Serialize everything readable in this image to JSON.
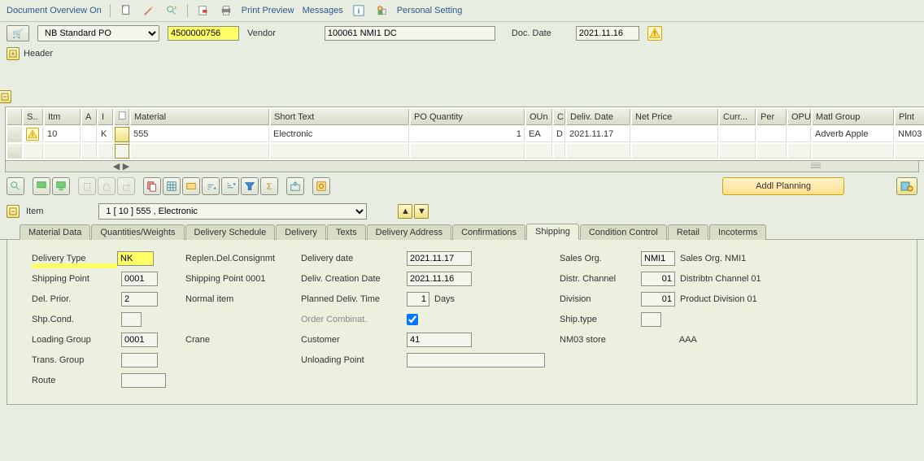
{
  "toolbar": {
    "doc_overview": "Document Overview On",
    "print_preview": "Print Preview",
    "messages": "Messages",
    "personal": "Personal Setting"
  },
  "header": {
    "doc_type_icon": "🛒",
    "doc_type": "NB Standard PO",
    "po_number": "4500000756",
    "vendor_label": "Vendor",
    "vendor_value": "100061 NMI1 DC",
    "doc_date_label": "Doc. Date",
    "doc_date_value": "2021.11.16",
    "header_toggle": "Header"
  },
  "item_grid": {
    "headers": [
      "",
      "S..",
      "Itm",
      "A",
      "I",
      "",
      "Material",
      "Short Text",
      "PO Quantity",
      "OUn",
      "C",
      "Deliv. Date",
      "Net Price",
      "Curr...",
      "Per",
      "OPU",
      "Matl Group",
      "Plnt"
    ],
    "row": {
      "status_icon": "⚠",
      "itm": "10",
      "a": "",
      "i": "K",
      "material": "555",
      "short_text": "Electronic",
      "qty": "1",
      "oun": "EA",
      "c": "D",
      "deliv_date": "2021.11.17",
      "net_price": "",
      "curr": "",
      "per": "",
      "opu": "",
      "matl_group": "Adverb Apple",
      "plnt": "NM03"
    }
  },
  "bottom_toolbar": {
    "addl_planning": "Addl Planning"
  },
  "item_select": {
    "label": "Item",
    "value": "1 [ 10 ] 555 , Electronic"
  },
  "tabs": [
    "Material Data",
    "Quantities/Weights",
    "Delivery Schedule",
    "Delivery",
    "Texts",
    "Delivery Address",
    "Confirmations",
    "Shipping",
    "Condition Control",
    "Retail",
    "Incoterms"
  ],
  "shipping": {
    "delivery_type_label": "Delivery Type",
    "delivery_type_value": "NK",
    "replen_del_consignmt": "Replen.Del.Consignmt",
    "shipping_point_label": "Shipping Point",
    "shipping_point_value": "0001",
    "shipping_point_text": "Shipping Point 0001",
    "del_prior_label": "Del. Prior.",
    "del_prior_value": "2",
    "normal_item": "Normal item",
    "shp_cond_label": "Shp.Cond.",
    "shp_cond_value": "",
    "loading_group_label": "Loading Group",
    "loading_group_value": "0001",
    "crane": "Crane",
    "trans_group_label": "Trans. Group",
    "trans_group_value": "",
    "route_label": "Route",
    "route_value": "",
    "delivery_date_label": "Delivery date",
    "delivery_date_value": "2021.11.17",
    "deliv_creation_label": "Deliv. Creation Date",
    "deliv_creation_value": "2021.11.16",
    "planned_deliv_label": "Planned Deliv. Time",
    "planned_deliv_value": "1",
    "planned_deliv_unit": "Days",
    "order_combinat_label": "Order Combinat.",
    "customer_label": "Customer",
    "customer_value": "41",
    "customer_text": "NM03 store",
    "customer_extra": "AAA",
    "unloading_label": "Unloading Point",
    "unloading_value": "",
    "sales_org_label": "Sales Org.",
    "sales_org_value": "NMI1",
    "sales_org_text": "Sales Org. NMI1",
    "distr_channel_label": "Distr. Channel",
    "distr_channel_value": "01",
    "distr_channel_text": "Distribtn Channel 01",
    "division_label": "Division",
    "division_value": "01",
    "division_text": "Product Division 01",
    "ship_type_label": "Ship.type",
    "ship_type_value": ""
  }
}
